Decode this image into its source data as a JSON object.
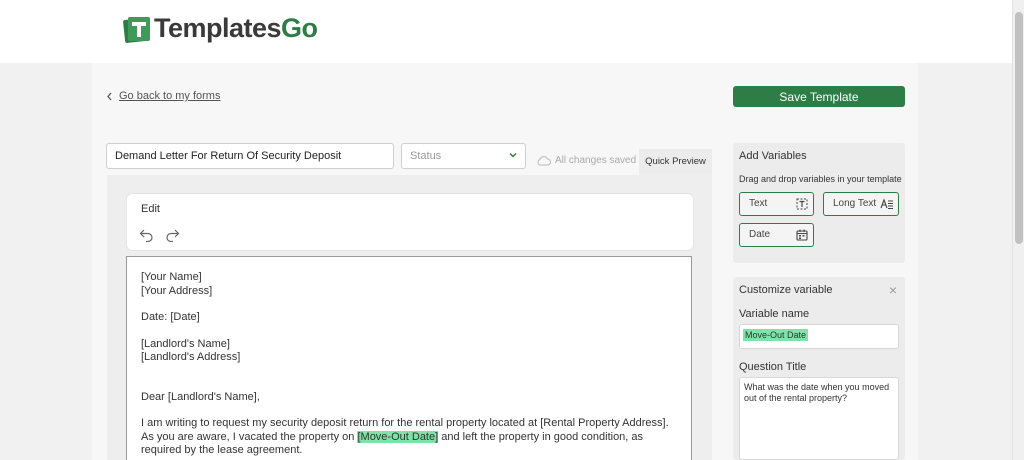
{
  "brand": {
    "name_part1": "Templates",
    "name_part2": "Go",
    "accent": "#2e7d46"
  },
  "nav": {
    "back_label": "Go back to my forms"
  },
  "toolbar": {
    "save_label": "Save Template"
  },
  "form": {
    "title_value": "Demand Letter For Return Of Security Deposit",
    "status_placeholder": "Status",
    "saved_text": "All changes saved",
    "preview_tab": "Quick Preview"
  },
  "editor": {
    "label": "Edit",
    "lines": {
      "name": "[Your Name]",
      "address": "[Your Address]",
      "date": "Date: [Date]",
      "landlord_name": "[Landlord's Name]",
      "landlord_address": "[Landlord's Address]",
      "greeting": "Dear [Landlord's Name],",
      "para_before": "I am writing to request my security deposit return for the rental property located at [Rental Property Address]. As you are aware, I vacated the property on ",
      "para_highlight": "[Move-Out Date]",
      "para_after": " and left the property in good condition, as required by the lease agreement."
    }
  },
  "add_variables": {
    "heading": "Add Variables",
    "subtitle": "Drag and drop variables in your template",
    "items": [
      {
        "label": "Text",
        "icon": "text-field-icon"
      },
      {
        "label": "Long Text",
        "icon": "long-text-icon"
      },
      {
        "label": "Date",
        "icon": "calendar-icon"
      }
    ]
  },
  "customize": {
    "heading": "Customize variable",
    "name_label": "Variable name",
    "name_value": "Move-Out Date",
    "question_label": "Question Title",
    "question_value": "What was the date when you moved out of the rental property?"
  }
}
